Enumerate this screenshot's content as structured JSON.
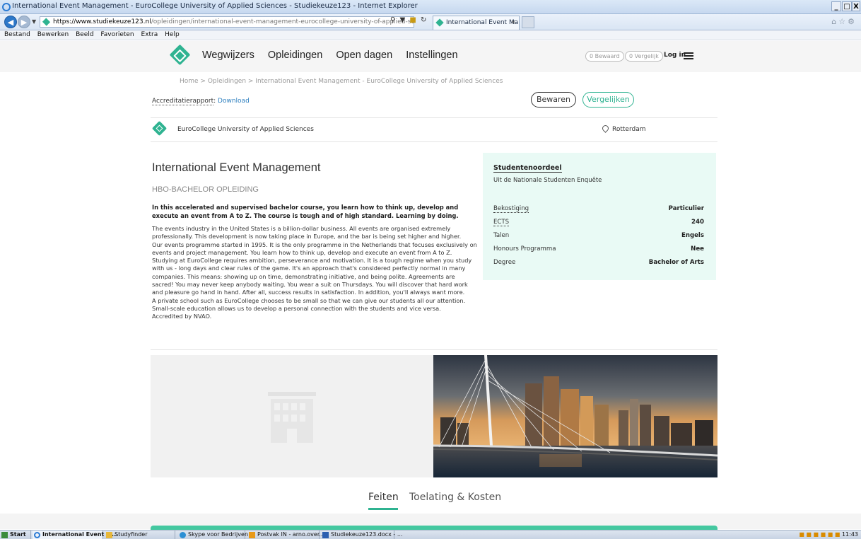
{
  "browser": {
    "window_title": "International Event Management - EuroCollege University of Applied Sciences - Studiekeuze123 - Internet Explorer",
    "url_host": "https://www.studiekeuze123.nl",
    "url_path": "/opleidingen/international-event-management-eurocollege-university-of-applied-sciences-hbo-bachelor",
    "tab_title": "International Event Manag...",
    "win_min": "_",
    "win_max": "Ђ",
    "win_close": "X",
    "menu": [
      "Bestand",
      "Bewerken",
      "Beeld",
      "Favorieten",
      "Extra",
      "Help"
    ]
  },
  "site": {
    "nav": [
      "Wegwijzers",
      "Opleidingen",
      "Open dagen",
      "Instellingen"
    ],
    "saved_pill": "0 Bewaard",
    "compare_pill": "0 Vergelijk",
    "login": "Log in"
  },
  "breadcrumb": "Home > Opleidingen > International Event Management - EuroCollege University of Applied Sciences",
  "accreditation": {
    "label": "Accreditatierapport",
    "link": "Download"
  },
  "actions": {
    "save": "Bewaren",
    "compare": "Vergelijken"
  },
  "institution": {
    "name": "EuroCollege University of Applied Sciences",
    "city": "Rotterdam"
  },
  "program": {
    "title": "International Event Management",
    "type": "HBO-BACHELOR OPLEIDING",
    "lead": "In this accelerated and supervised bachelor course, you learn how to think up, develop and execute an event from A to Z. The course is tough and of high standard. Learning by doing.",
    "body": [
      "The events industry in the United States is a billion-dollar business. All events are organised extremely professionally. This development is now taking place in Europe, and the bar is being set higher and higher.",
      "Our events programme started in 1995. It is the only programme in the Netherlands that focuses exclusively on events and project management. You learn how to think up, develop and execute an event from A to Z.",
      "Studying at EuroCollege requires ambition, perseverance and motivation. It is a tough regime when you study with us - long days and clear rules of the game. It's an approach that's considered perfectly normal in many companies. This means: showing up on time, demonstrating initiative, and being polite. Agreements are sacred! You may never keep anybody waiting. You wear a suit on Thursdays. You will discover that hard work and pleasure go hand in hand. After all, success results in satisfaction. In addition, you'll always want more.",
      "A private school such as EuroCollege chooses to be small so that we can give our students all our attention. Small-scale education allows us to develop a personal connection with the students and vice versa.",
      "Accredited by NVAO."
    ]
  },
  "facts_panel": {
    "heading": "Studentenoordeel",
    "subheading": "Uit de Nationale Studenten Enquête",
    "rows": [
      {
        "key": "Bekostiging",
        "value": "Particulier"
      },
      {
        "key": "ECTS",
        "value": "240"
      },
      {
        "key": "Talen",
        "value": "Engels"
      },
      {
        "key": "Honours Programma",
        "value": "Nee"
      },
      {
        "key": "Degree",
        "value": "Bachelor of Arts"
      }
    ]
  },
  "tabs": {
    "facts": "Feiten",
    "admission": "Toelating & Kosten"
  },
  "taskbar": {
    "start": "Start",
    "items": [
      "International Event M...",
      "Studyfinder",
      "Skype voor Bedrijven",
      "Postvak IN - arno.over...",
      "Studiekeuze123.docx - ..."
    ],
    "clock": "11:43"
  },
  "colors": {
    "brand": "#2fb391",
    "panel_bg": "#e9faf5",
    "link": "#2d7fbf"
  }
}
